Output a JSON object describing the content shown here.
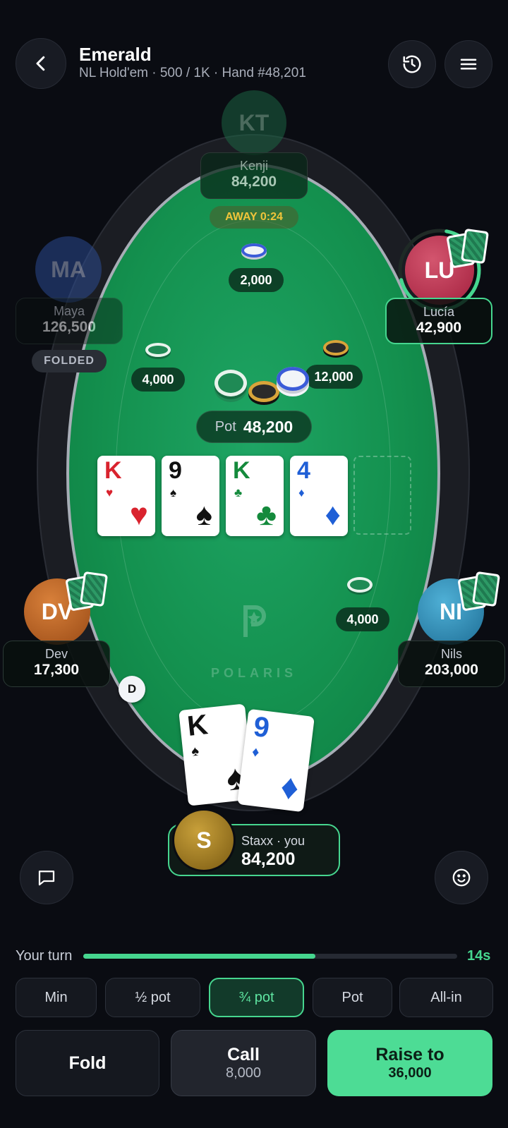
{
  "header": {
    "title": "Emerald",
    "subtitle": "NL Hold'em · 500 / 1K · Hand #48,201"
  },
  "players": {
    "kenji": {
      "initials": "KT",
      "name": "Kenji",
      "stack": "84,200",
      "status": "AWAY 0:24",
      "bet": "2,000"
    },
    "maya": {
      "initials": "MA",
      "name": "Maya",
      "stack": "126,500",
      "status": "FOLDED",
      "bet": "4,000"
    },
    "lucia": {
      "initials": "LU",
      "name": "Lucía",
      "stack": "42,900",
      "bet": "12,000"
    },
    "dev": {
      "initials": "DV",
      "name": "Dev",
      "stack": "17,300"
    },
    "nils": {
      "initials": "NI",
      "name": "Nils",
      "stack": "203,000",
      "bet": "4,000"
    },
    "hero": {
      "initials": "S",
      "name": "Staxx · you",
      "stack": "84,200"
    }
  },
  "dealer_button": "D",
  "pot": {
    "label": "Pot",
    "amount": "48,200"
  },
  "board": [
    {
      "rank": "K",
      "suit": "♥",
      "color": "#d9232e"
    },
    {
      "rank": "9",
      "suit": "♠",
      "color": "#111111"
    },
    {
      "rank": "K",
      "suit": "♣",
      "color": "#148a3c"
    },
    {
      "rank": "4",
      "suit": "♦",
      "color": "#1f5fd6"
    }
  ],
  "hole_cards": [
    {
      "rank": "K",
      "suit": "♠",
      "color": "#111111"
    },
    {
      "rank": "9",
      "suit": "♦",
      "color": "#1f5fd6"
    }
  ],
  "table_brand": "POLARIS",
  "turn": {
    "label": "Your turn",
    "timer": "14s",
    "progress": 0.62
  },
  "presets": [
    "Min",
    "½ pot",
    "¾ pot",
    "Pot",
    "All-in"
  ],
  "actions": {
    "fold": "Fold",
    "call": {
      "label": "Call",
      "amount": "8,000"
    },
    "raise": {
      "label": "Raise to",
      "amount": "36,000"
    }
  },
  "colors": {
    "accent": "#46d68f",
    "felt": "#14914f"
  }
}
